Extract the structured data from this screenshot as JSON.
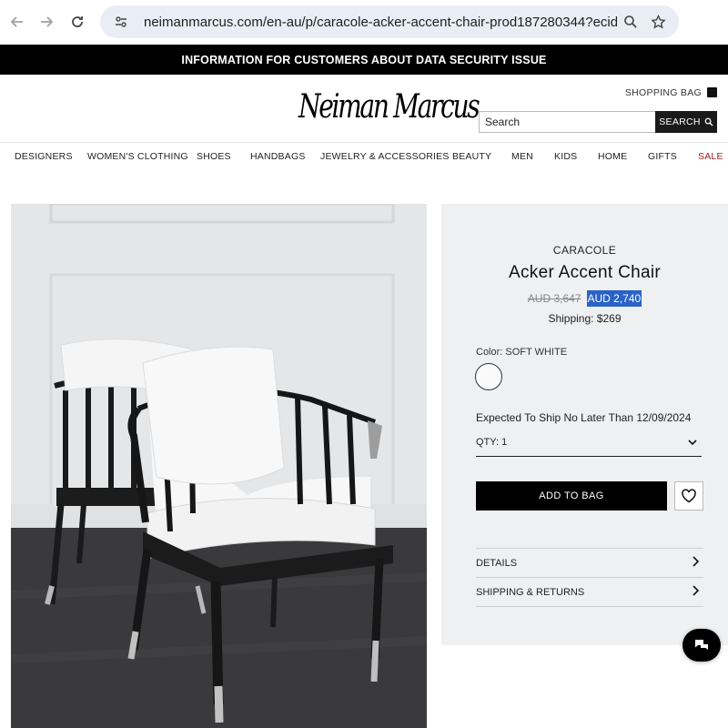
{
  "browser": {
    "url": "neimanmarcus.com/en-au/p/caracole-acker-accent-chair-prod187280344?ecid=NMAF_...",
    "icons": [
      "back-arrow-icon",
      "forward-arrow-icon",
      "reload-icon",
      "site-settings-icon",
      "zoom-icon",
      "bookmark-star-icon"
    ]
  },
  "banner": {
    "text": "INFORMATION FOR CUSTOMERS ABOUT DATA SECURITY ISSUE"
  },
  "header": {
    "logo_text": "Neiman Marcus",
    "shopping_bag_label": "SHOPPING BAG",
    "search_placeholder": "Search",
    "search_button_label": "SEARCH"
  },
  "nav": {
    "items": [
      "DESIGNERS",
      "WOMEN'S CLOTHING",
      "SHOES",
      "HANDBAGS",
      "JEWELRY & ACCESSORIES",
      "BEAUTY",
      "MEN",
      "KIDS",
      "HOME",
      "GIFTS",
      "SALE"
    ]
  },
  "product": {
    "brand": "CARACOLE",
    "name": "Acker Accent Chair",
    "old_price": "AUD 3,647",
    "price": "AUD 2,740",
    "shipping": "Shipping: $269",
    "color_label": "Color: SOFT WHITE",
    "ship_date": "Expected To Ship No Later Than 12/09/2024",
    "qty_label": "QTY: 1",
    "add_to_bag_label": "ADD TO BAG",
    "details_label": "DETAILS",
    "shipping_returns_label": "SHIPPING & RETURNS"
  },
  "colors": {
    "accent_black": "#000000",
    "sale_red": "#9b1c1c",
    "price_highlight": "#2a62c9",
    "panel_bg": "#eef0f2"
  }
}
